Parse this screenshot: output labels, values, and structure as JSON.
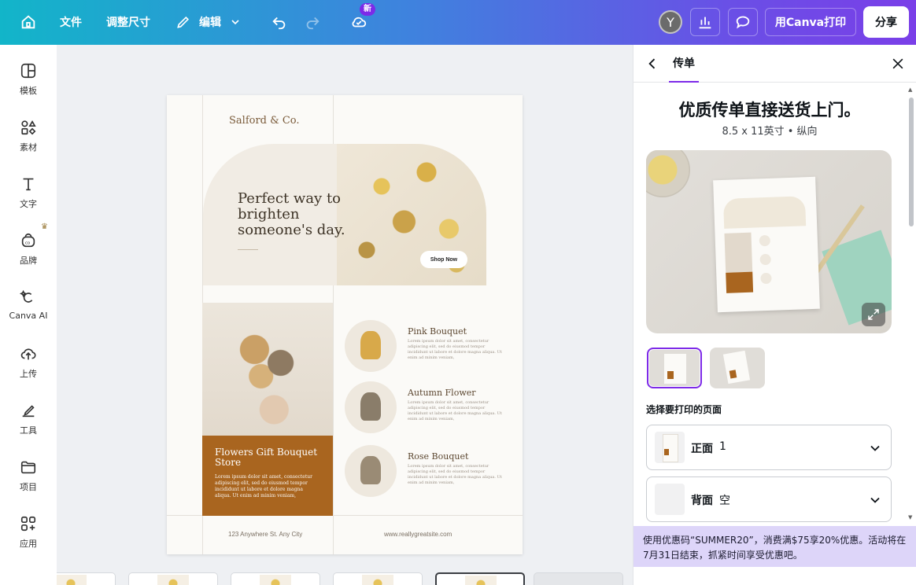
{
  "topbar": {
    "file_label": "文件",
    "resize_label": "调整尺寸",
    "edit_label": "编辑",
    "new_badge": "新",
    "avatar_initial": "Y",
    "print_label": "用Canva打印",
    "share_label": "分享"
  },
  "sidebar": {
    "items": [
      {
        "label": "模板",
        "icon": "template-icon"
      },
      {
        "label": "素材",
        "icon": "elements-icon"
      },
      {
        "label": "文字",
        "icon": "text-icon"
      },
      {
        "label": "品牌",
        "icon": "brand-icon"
      },
      {
        "label": "Canva AI",
        "icon": "canva-ai-icon"
      },
      {
        "label": "上传",
        "icon": "upload-icon"
      },
      {
        "label": "工具",
        "icon": "tools-icon"
      },
      {
        "label": "项目",
        "icon": "projects-icon"
      },
      {
        "label": "应用",
        "icon": "apps-icon"
      }
    ]
  },
  "design": {
    "brand": "Salford & Co.",
    "hero_title": "Perfect way to brighten someone's day.",
    "shop_button": "Shop Now",
    "store_title": "Flowers Gift Bouquet Store",
    "store_text": "Lorem ipsum dolor sit amet, consectetur adipiscing elit, sed do eiusmod tempor incididunt ut labore et dolore magna aliqua. Ut enim ad minim veniam,",
    "products": [
      {
        "name": "Pink Bouquet",
        "text": "Lorem ipsum dolor sit amet, consectetur adipiscing elit, sed do eiusmod tempor incididunt ut labore et dolore magna aliqua. Ut enim ad minim veniam,"
      },
      {
        "name": "Autumn Flower",
        "text": "Lorem ipsum dolor sit amet, consectetur adipiscing elit, sed do eiusmod tempor incididunt ut labore et dolore magna aliqua. Ut enim ad minim veniam,"
      },
      {
        "name": "Rose Bouquet",
        "text": "Lorem ipsum dolor sit amet, consectetur adipiscing elit, sed do eiusmod tempor incididunt ut labore et dolore magna aliqua. Ut enim ad minim veniam,"
      }
    ],
    "address": "123 Anywhere St. Any City",
    "website": "www.reallygreatsite.com"
  },
  "panel": {
    "tab_label": "传单",
    "title": "优质传单直接送货上门。",
    "subtitle": "8.5 x 11英寸 • 纵向",
    "select_pages_label": "选择要打印的页面",
    "front": {
      "label": "正面",
      "value": "1"
    },
    "back": {
      "label": "背面",
      "value": "空"
    },
    "promo": "使用优惠码“SUMMER20”，消费满$75享20%优惠。活动将在7月31日结束，抓紧时间享受优惠吧。"
  },
  "colors": {
    "accent": "#7d2ae8",
    "store_brown": "#a9651f",
    "promo_bg": "#ddd5f9"
  }
}
